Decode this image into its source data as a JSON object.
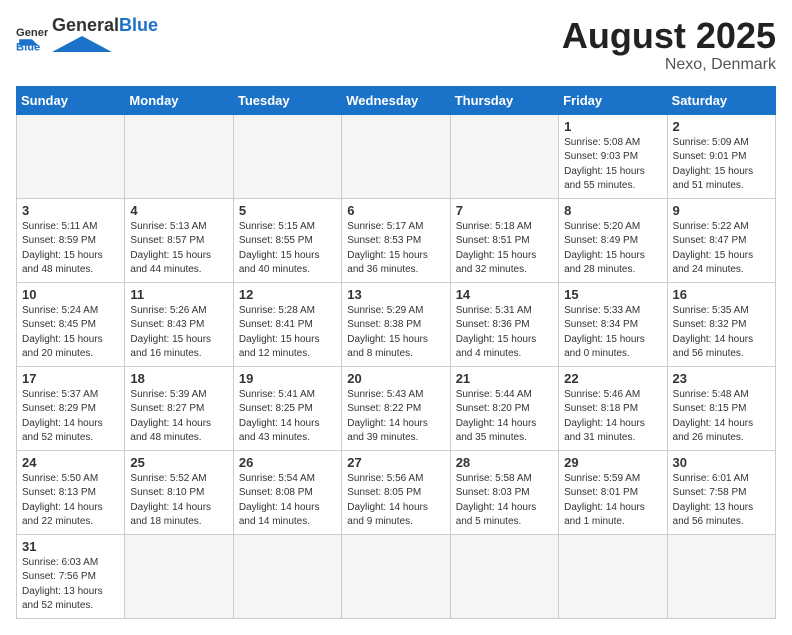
{
  "header": {
    "logo_general": "General",
    "logo_blue": "Blue",
    "title": "August 2025",
    "subtitle": "Nexo, Denmark"
  },
  "days_of_week": [
    "Sunday",
    "Monday",
    "Tuesday",
    "Wednesday",
    "Thursday",
    "Friday",
    "Saturday"
  ],
  "weeks": [
    [
      {
        "day": "",
        "info": ""
      },
      {
        "day": "",
        "info": ""
      },
      {
        "day": "",
        "info": ""
      },
      {
        "day": "",
        "info": ""
      },
      {
        "day": "",
        "info": ""
      },
      {
        "day": "1",
        "info": "Sunrise: 5:08 AM\nSunset: 9:03 PM\nDaylight: 15 hours and 55 minutes."
      },
      {
        "day": "2",
        "info": "Sunrise: 5:09 AM\nSunset: 9:01 PM\nDaylight: 15 hours and 51 minutes."
      }
    ],
    [
      {
        "day": "3",
        "info": "Sunrise: 5:11 AM\nSunset: 8:59 PM\nDaylight: 15 hours and 48 minutes."
      },
      {
        "day": "4",
        "info": "Sunrise: 5:13 AM\nSunset: 8:57 PM\nDaylight: 15 hours and 44 minutes."
      },
      {
        "day": "5",
        "info": "Sunrise: 5:15 AM\nSunset: 8:55 PM\nDaylight: 15 hours and 40 minutes."
      },
      {
        "day": "6",
        "info": "Sunrise: 5:17 AM\nSunset: 8:53 PM\nDaylight: 15 hours and 36 minutes."
      },
      {
        "day": "7",
        "info": "Sunrise: 5:18 AM\nSunset: 8:51 PM\nDaylight: 15 hours and 32 minutes."
      },
      {
        "day": "8",
        "info": "Sunrise: 5:20 AM\nSunset: 8:49 PM\nDaylight: 15 hours and 28 minutes."
      },
      {
        "day": "9",
        "info": "Sunrise: 5:22 AM\nSunset: 8:47 PM\nDaylight: 15 hours and 24 minutes."
      }
    ],
    [
      {
        "day": "10",
        "info": "Sunrise: 5:24 AM\nSunset: 8:45 PM\nDaylight: 15 hours and 20 minutes."
      },
      {
        "day": "11",
        "info": "Sunrise: 5:26 AM\nSunset: 8:43 PM\nDaylight: 15 hours and 16 minutes."
      },
      {
        "day": "12",
        "info": "Sunrise: 5:28 AM\nSunset: 8:41 PM\nDaylight: 15 hours and 12 minutes."
      },
      {
        "day": "13",
        "info": "Sunrise: 5:29 AM\nSunset: 8:38 PM\nDaylight: 15 hours and 8 minutes."
      },
      {
        "day": "14",
        "info": "Sunrise: 5:31 AM\nSunset: 8:36 PM\nDaylight: 15 hours and 4 minutes."
      },
      {
        "day": "15",
        "info": "Sunrise: 5:33 AM\nSunset: 8:34 PM\nDaylight: 15 hours and 0 minutes."
      },
      {
        "day": "16",
        "info": "Sunrise: 5:35 AM\nSunset: 8:32 PM\nDaylight: 14 hours and 56 minutes."
      }
    ],
    [
      {
        "day": "17",
        "info": "Sunrise: 5:37 AM\nSunset: 8:29 PM\nDaylight: 14 hours and 52 minutes."
      },
      {
        "day": "18",
        "info": "Sunrise: 5:39 AM\nSunset: 8:27 PM\nDaylight: 14 hours and 48 minutes."
      },
      {
        "day": "19",
        "info": "Sunrise: 5:41 AM\nSunset: 8:25 PM\nDaylight: 14 hours and 43 minutes."
      },
      {
        "day": "20",
        "info": "Sunrise: 5:43 AM\nSunset: 8:22 PM\nDaylight: 14 hours and 39 minutes."
      },
      {
        "day": "21",
        "info": "Sunrise: 5:44 AM\nSunset: 8:20 PM\nDaylight: 14 hours and 35 minutes."
      },
      {
        "day": "22",
        "info": "Sunrise: 5:46 AM\nSunset: 8:18 PM\nDaylight: 14 hours and 31 minutes."
      },
      {
        "day": "23",
        "info": "Sunrise: 5:48 AM\nSunset: 8:15 PM\nDaylight: 14 hours and 26 minutes."
      }
    ],
    [
      {
        "day": "24",
        "info": "Sunrise: 5:50 AM\nSunset: 8:13 PM\nDaylight: 14 hours and 22 minutes."
      },
      {
        "day": "25",
        "info": "Sunrise: 5:52 AM\nSunset: 8:10 PM\nDaylight: 14 hours and 18 minutes."
      },
      {
        "day": "26",
        "info": "Sunrise: 5:54 AM\nSunset: 8:08 PM\nDaylight: 14 hours and 14 minutes."
      },
      {
        "day": "27",
        "info": "Sunrise: 5:56 AM\nSunset: 8:05 PM\nDaylight: 14 hours and 9 minutes."
      },
      {
        "day": "28",
        "info": "Sunrise: 5:58 AM\nSunset: 8:03 PM\nDaylight: 14 hours and 5 minutes."
      },
      {
        "day": "29",
        "info": "Sunrise: 5:59 AM\nSunset: 8:01 PM\nDaylight: 14 hours and 1 minute."
      },
      {
        "day": "30",
        "info": "Sunrise: 6:01 AM\nSunset: 7:58 PM\nDaylight: 13 hours and 56 minutes."
      }
    ],
    [
      {
        "day": "31",
        "info": "Sunrise: 6:03 AM\nSunset: 7:56 PM\nDaylight: 13 hours and 52 minutes."
      },
      {
        "day": "",
        "info": ""
      },
      {
        "day": "",
        "info": ""
      },
      {
        "day": "",
        "info": ""
      },
      {
        "day": "",
        "info": ""
      },
      {
        "day": "",
        "info": ""
      },
      {
        "day": "",
        "info": ""
      }
    ]
  ]
}
